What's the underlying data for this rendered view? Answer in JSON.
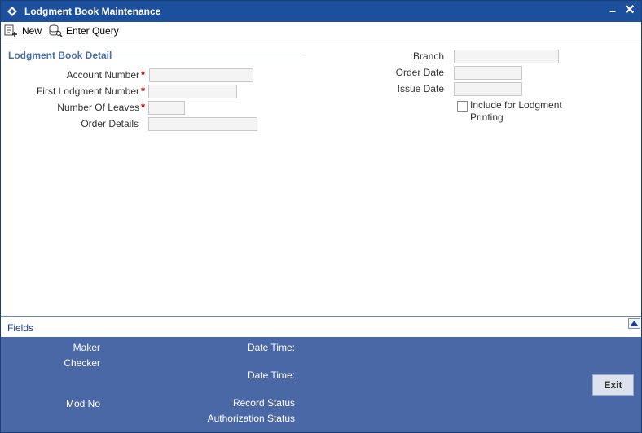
{
  "window": {
    "title": "Lodgment Book Maintenance",
    "minimize_label": "–",
    "close_label": "✕"
  },
  "toolbar": {
    "new_label": "New",
    "enter_query_label": "Enter Query"
  },
  "detail": {
    "section_title": "Lodgment Book Detail",
    "account_number_label": "Account Number",
    "first_lodgment_number_label": "First Lodgment Number",
    "number_of_leaves_label": "Number Of Leaves",
    "order_details_label": "Order Details",
    "required_marker": "*",
    "account_number_value": "",
    "first_lodgment_number_value": "",
    "number_of_leaves_value": "",
    "order_details_value": ""
  },
  "right": {
    "branch_label": "Branch",
    "order_date_label": "Order Date",
    "issue_date_label": "Issue Date",
    "branch_value": "",
    "order_date_value": "",
    "issue_date_value": "",
    "include_label": "Include for Lodgment Printing",
    "include_checked": false
  },
  "fields_bar": {
    "label": "Fields"
  },
  "footer": {
    "maker_label": "Maker",
    "checker_label": "Checker",
    "date_time_label_1": "Date Time:",
    "date_time_label_2": "Date Time:",
    "mod_no_label": "Mod No",
    "record_status_label": "Record Status",
    "authorization_status_label": "Authorization Status",
    "exit_label": "Exit"
  },
  "colors": {
    "titlebar": "#1c4f9c",
    "footer": "#4a67a6",
    "section_title": "#4a6ea8",
    "required": "#c00000"
  }
}
